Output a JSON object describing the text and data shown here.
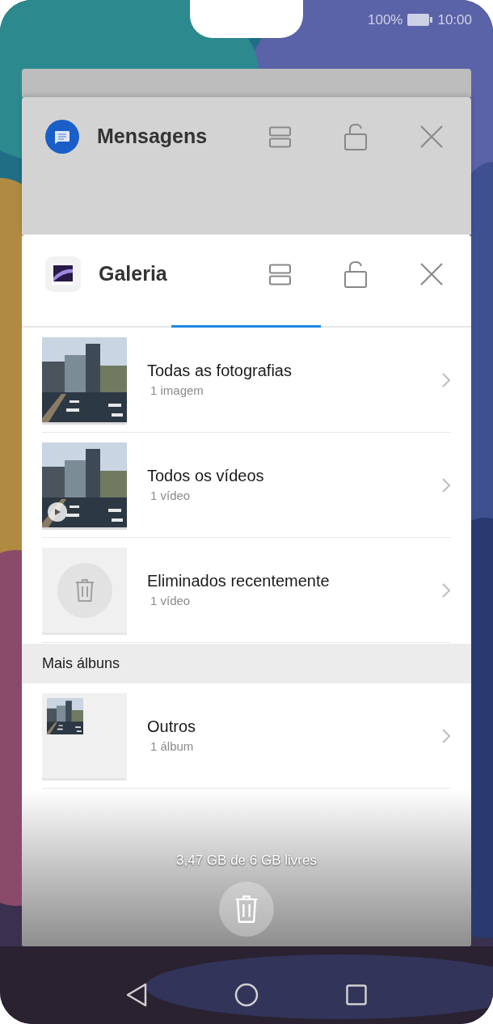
{
  "status_bar": {
    "battery_text": "100%",
    "time": "10:00"
  },
  "recent_apps": [
    {
      "kind": "messages",
      "title": "Mensagens",
      "dimmed": true
    },
    {
      "kind": "gallery",
      "title": "Galeria",
      "dimmed": false
    }
  ],
  "gallery": {
    "albums": [
      {
        "title": "Todas as fotografias",
        "count": "1 imagem"
      },
      {
        "kind": "video",
        "title": "Todos os vídeos",
        "count": "1 vídeo"
      },
      {
        "kind": "trash",
        "title": "Eliminados recentemente",
        "count": "1 vídeo"
      }
    ],
    "section_title": "Mais álbuns",
    "other_albums": [
      {
        "kind": "mini",
        "title": "Outros",
        "count": "1 álbum"
      }
    ],
    "storage_text": "3,47 GB de 6 GB livres"
  }
}
